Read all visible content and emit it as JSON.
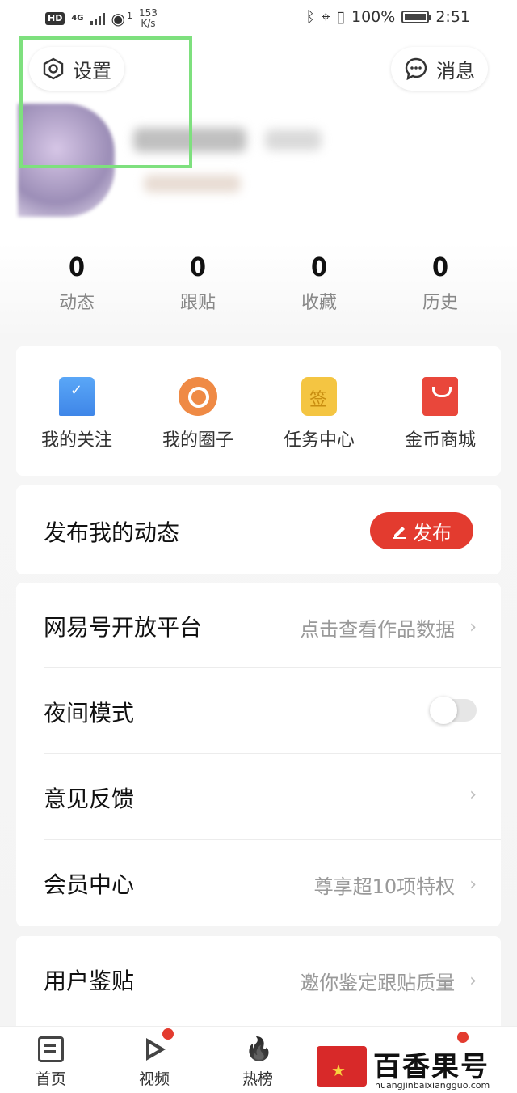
{
  "status_bar": {
    "network_badge": "HD",
    "network_type": "4G",
    "hotspot_count": "1",
    "speed_value": "153",
    "speed_unit": "K/s",
    "battery": "100%",
    "time": "2:51"
  },
  "header": {
    "settings_label": "设置",
    "message_label": "消息"
  },
  "stats": [
    {
      "value": "0",
      "label": "动态"
    },
    {
      "value": "0",
      "label": "跟贴"
    },
    {
      "value": "0",
      "label": "收藏"
    },
    {
      "value": "0",
      "label": "历史"
    }
  ],
  "quick_actions": [
    {
      "label": "我的关注",
      "icon": "bookmark-check-icon"
    },
    {
      "label": "我的圈子",
      "icon": "chat-circle-icon"
    },
    {
      "label": "任务中心",
      "icon": "sign-in-calendar-icon"
    },
    {
      "label": "金币商城",
      "icon": "shopping-bag-icon"
    }
  ],
  "publish": {
    "title": "发布我的动态",
    "button_label": "发布"
  },
  "menu": [
    {
      "title": "网易号开放平台",
      "hint": "点击查看作品数据"
    },
    {
      "title": "夜间模式",
      "hint": ""
    },
    {
      "title": "意见反馈",
      "hint": ""
    },
    {
      "title": "会员中心",
      "hint": "尊享超10项特权"
    }
  ],
  "menu2": [
    {
      "title": "用户鉴贴",
      "hint": "邀你鉴定跟贴质量"
    }
  ],
  "bottom_nav": [
    {
      "label": "首页"
    },
    {
      "label": "视频"
    },
    {
      "label": "热榜"
    }
  ],
  "watermark": {
    "name": "百香果号",
    "url": "huangjinbaixiangguo.com"
  },
  "colors": {
    "accent_red": "#e33b2f",
    "highlight_green": "#7ee07e"
  }
}
